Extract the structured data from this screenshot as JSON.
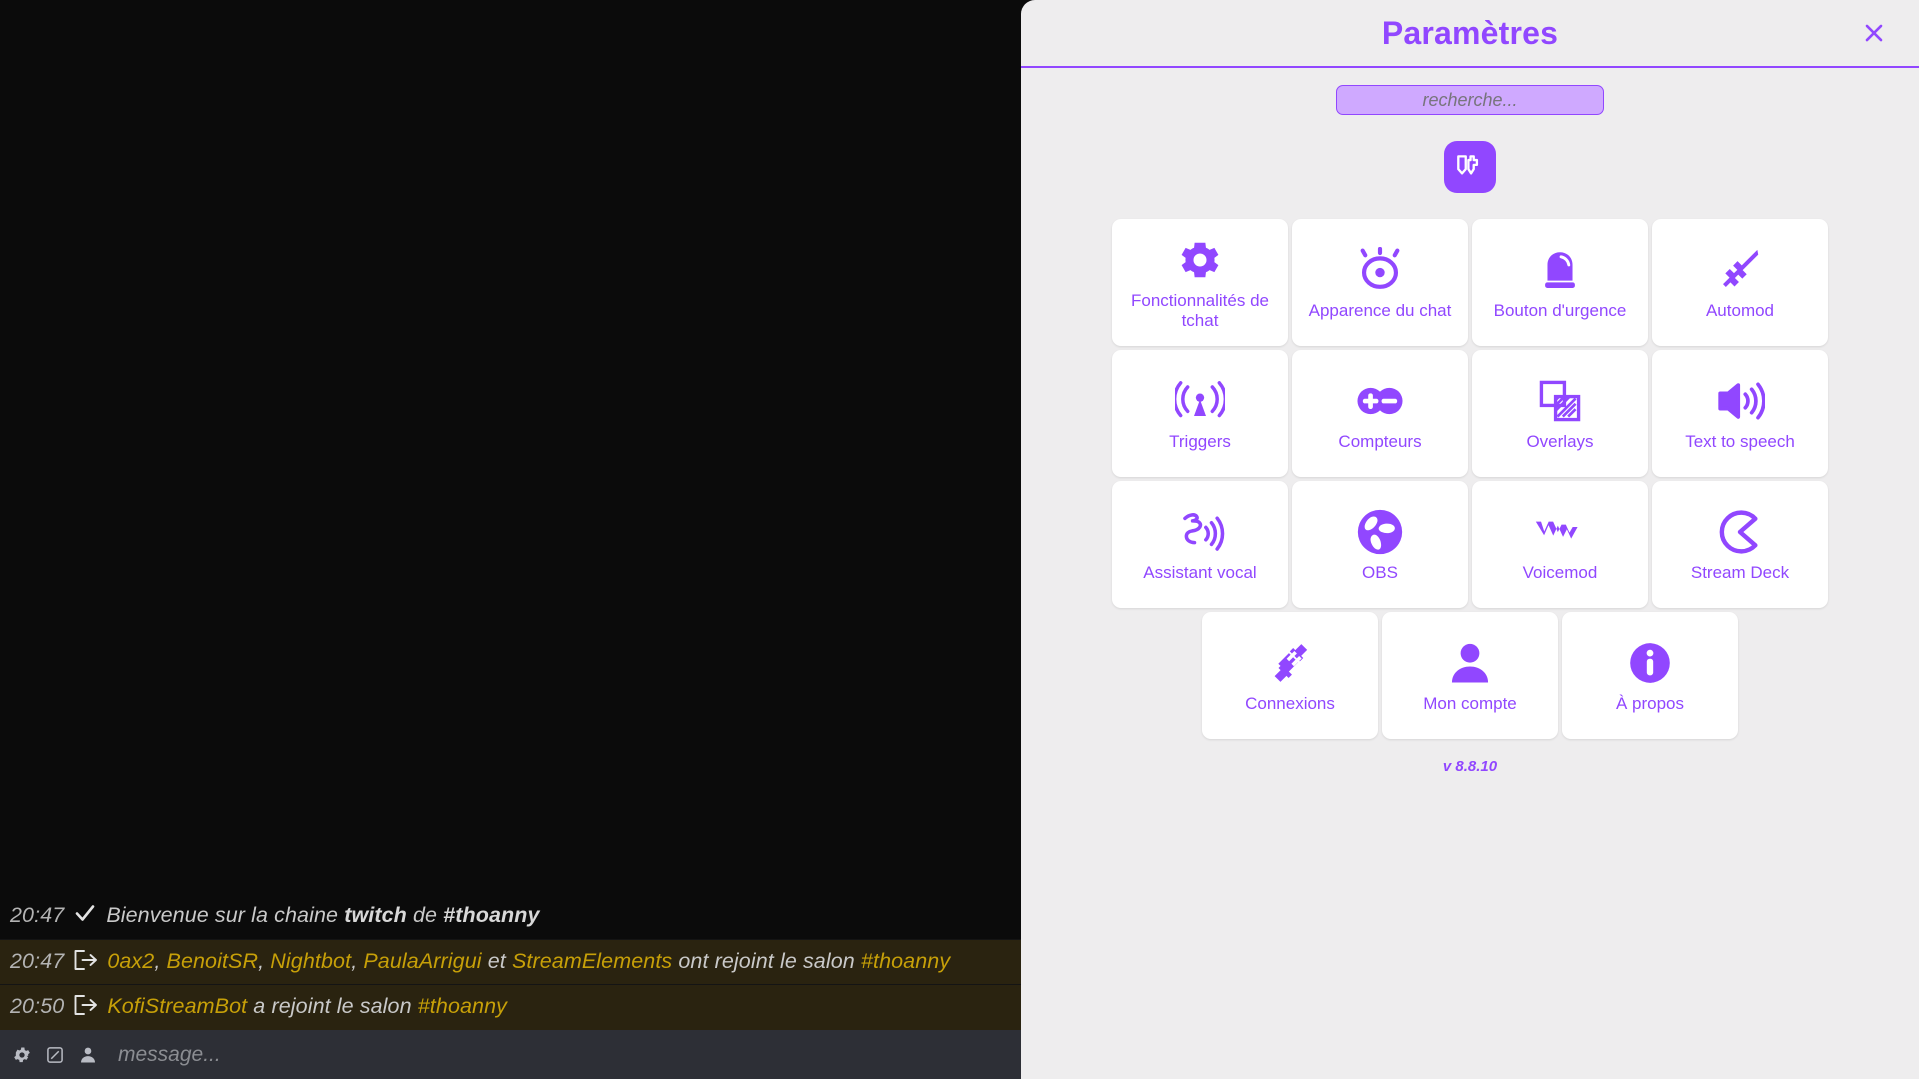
{
  "settings": {
    "title": "Paramètres",
    "close_icon": "close-icon",
    "search": {
      "placeholder": "recherche...",
      "value": ""
    },
    "brand_icon": "twitch-logo-icon",
    "version": "v 8.8.10",
    "accent_color": "#9147ff",
    "panel_bg": "#eeedee",
    "tile_bg": "#ffffff",
    "tiles": [
      [
        {
          "label": "Fonctionnalités de tchat",
          "icon": "gear-icon"
        },
        {
          "label": "Apparence du chat",
          "icon": "eye-icon"
        },
        {
          "label": "Bouton d'urgence",
          "icon": "siren-icon"
        },
        {
          "label": "Automod",
          "icon": "sword-icon"
        }
      ],
      [
        {
          "label": "Triggers",
          "icon": "broadcast-antenna-icon"
        },
        {
          "label": "Compteurs",
          "icon": "plus-minus-icon"
        },
        {
          "label": "Overlays",
          "icon": "overlapping-squares-icon"
        },
        {
          "label": "Text to speech",
          "icon": "speaker-icon"
        }
      ],
      [
        {
          "label": "Assistant vocal",
          "icon": "speaking-head-icon"
        },
        {
          "label": "OBS",
          "icon": "obs-logo-icon"
        },
        {
          "label": "Voicemod",
          "icon": "voicemod-logo-icon"
        },
        {
          "label": "Stream Deck",
          "icon": "elgato-logo-icon"
        }
      ],
      [
        {
          "label": "Connexions",
          "icon": "plug-connect-icon"
        },
        {
          "label": "Mon compte",
          "icon": "person-icon"
        },
        {
          "label": "À propos",
          "icon": "info-circle-icon"
        }
      ]
    ]
  },
  "chat": {
    "input": {
      "placeholder": "message...",
      "value": ""
    },
    "toolbar_icons": [
      "gear-icon",
      "square-slash-icon",
      "person-icon"
    ],
    "messages": [
      {
        "time": "20:47",
        "icon": "checkmark-icon",
        "type": "system",
        "parts": [
          {
            "text": "Bienvenue sur la chaine ",
            "style": "text"
          },
          {
            "text": "twitch",
            "style": "strong"
          },
          {
            "text": " de ",
            "style": "text"
          },
          {
            "text": "#thoanny",
            "style": "strong"
          }
        ]
      },
      {
        "time": "20:47",
        "icon": "join-arrow-icon",
        "type": "join",
        "parts": [
          {
            "text": "0ax2",
            "style": "user"
          },
          {
            "text": ", ",
            "style": "text"
          },
          {
            "text": "BenoitSR",
            "style": "user"
          },
          {
            "text": ", ",
            "style": "text"
          },
          {
            "text": "Nightbot",
            "style": "user"
          },
          {
            "text": ", ",
            "style": "text"
          },
          {
            "text": "PaulaArrigui",
            "style": "user"
          },
          {
            "text": " et ",
            "style": "text"
          },
          {
            "text": "StreamElements",
            "style": "user"
          },
          {
            "text": " ont rejoint le salon ",
            "style": "text"
          },
          {
            "text": "#thoanny",
            "style": "chan"
          }
        ]
      },
      {
        "time": "20:50",
        "icon": "join-arrow-icon",
        "type": "join",
        "parts": [
          {
            "text": "KofiStreamBot",
            "style": "user"
          },
          {
            "text": " a rejoint le salon ",
            "style": "text"
          },
          {
            "text": "#thoanny",
            "style": "chan"
          }
        ]
      }
    ]
  }
}
